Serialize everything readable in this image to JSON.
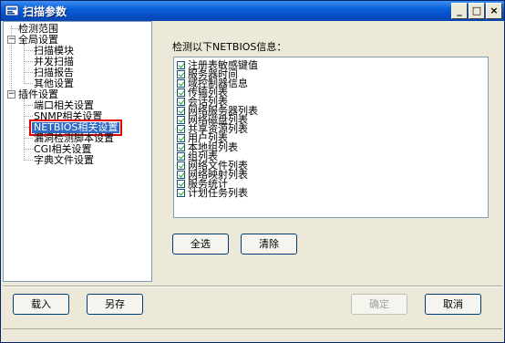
{
  "window": {
    "title": "扫描参数",
    "minimize": "_",
    "maximize": "□",
    "close": "×"
  },
  "tree": {
    "items": [
      {
        "label": "检测范围",
        "level": 1
      },
      {
        "label": "全局设置",
        "level": 0,
        "expander": "−"
      },
      {
        "label": "扫描模块",
        "level": 2
      },
      {
        "label": "并发扫描",
        "level": 2
      },
      {
        "label": "扫描报告",
        "level": 2
      },
      {
        "label": "其他设置",
        "level": 2
      },
      {
        "label": "插件设置",
        "level": 0,
        "expander": "−"
      },
      {
        "label": "端口相关设置",
        "level": 2
      },
      {
        "label": "SNMP相关设置",
        "level": 2
      },
      {
        "label": "NETBIOS相关设置",
        "level": 2,
        "selected": true
      },
      {
        "label": "漏洞检测脚本设置",
        "level": 2
      },
      {
        "label": "CGI相关设置",
        "level": 2
      },
      {
        "label": "字典文件设置",
        "level": 2
      }
    ]
  },
  "panel": {
    "heading": "检测以下NETBIOS信息：",
    "checklist": [
      {
        "label": "注册表敏感键值",
        "checked": true
      },
      {
        "label": "服务器时间",
        "checked": true
      },
      {
        "label": "域控制器信息",
        "checked": true
      },
      {
        "label": "传输列表",
        "checked": true
      },
      {
        "label": "会话列表",
        "checked": true
      },
      {
        "label": "网络服务器列表",
        "checked": true
      },
      {
        "label": "网络磁盘列表",
        "checked": true
      },
      {
        "label": "共享资源列表",
        "checked": true
      },
      {
        "label": "用户列表",
        "checked": true
      },
      {
        "label": "本地组列表",
        "checked": true
      },
      {
        "label": "组列表",
        "checked": true
      },
      {
        "label": "网络文件列表",
        "checked": true
      },
      {
        "label": "网络映射列表",
        "checked": true
      },
      {
        "label": "服务统计",
        "checked": true
      },
      {
        "label": "计划任务列表",
        "checked": true
      }
    ],
    "select_all_label": "全选",
    "clear_label": "清除"
  },
  "footer": {
    "load_label": "载入",
    "save_as_label": "另存",
    "ok_label": "确定",
    "cancel_label": "取消"
  }
}
